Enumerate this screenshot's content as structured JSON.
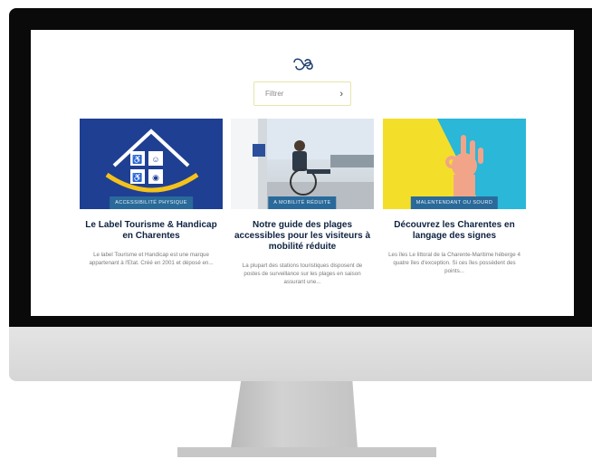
{
  "filter": {
    "label": "Filtrer"
  },
  "cards": [
    {
      "tag": "ACCESSIBILITÉ PHYSIQUE",
      "title": "Le Label Tourisme & Handicap en Charentes",
      "excerpt": "Le label Tourisme et Handicap est une marque appartenant à l'Etat. Créé en 2001 et déposé en..."
    },
    {
      "tag": "A MOBILITÉ RÉDUITE",
      "title": "Notre guide des plages accessibles pour les visiteurs à mobilité réduite",
      "excerpt": "La plupart des stations touristiques disposent de postes de surveillance sur les plages en saison assurant une..."
    },
    {
      "tag": "MALENTENDANT OU SOURD",
      "title": "Découvrez les Charentes en langage des signes",
      "excerpt": "Les îles Le littoral de la Charente-Maritime héberge 4 quatre îles d'exception. Si ces îles possèdent des points..."
    }
  ]
}
